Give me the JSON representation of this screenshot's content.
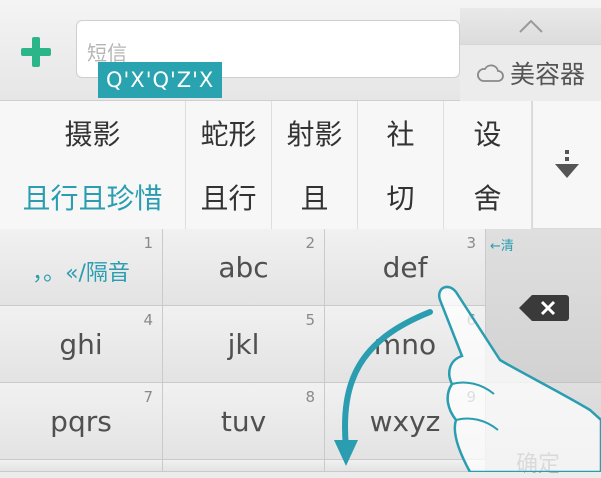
{
  "top": {
    "sms_placeholder": "短信",
    "pinyin": "Q'X'Q'Z'X",
    "cloud_suggestion": "美容器"
  },
  "candidates": {
    "row1": [
      "摄影",
      "蛇形",
      "射影",
      "社",
      "设"
    ],
    "row2": [
      "且行且珍惜",
      "且行",
      "且",
      "切",
      "舍"
    ]
  },
  "keys": [
    {
      "label": "，。«/隔音",
      "num": "1"
    },
    {
      "label": "abc",
      "num": "2"
    },
    {
      "label": "def",
      "num": "3"
    },
    {
      "label": "ghi",
      "num": "4"
    },
    {
      "label": "jkl",
      "num": "5"
    },
    {
      "label": "mno",
      "num": "6"
    },
    {
      "label": "pqrs",
      "num": "7"
    },
    {
      "label": "tuv",
      "num": "8"
    },
    {
      "label": "wxyz",
      "num": "9"
    }
  ],
  "functions": {
    "clear_hint": "←清",
    "confirm": "确定"
  },
  "colors": {
    "accent": "#2aa3b0",
    "plus": "#2db58a"
  }
}
